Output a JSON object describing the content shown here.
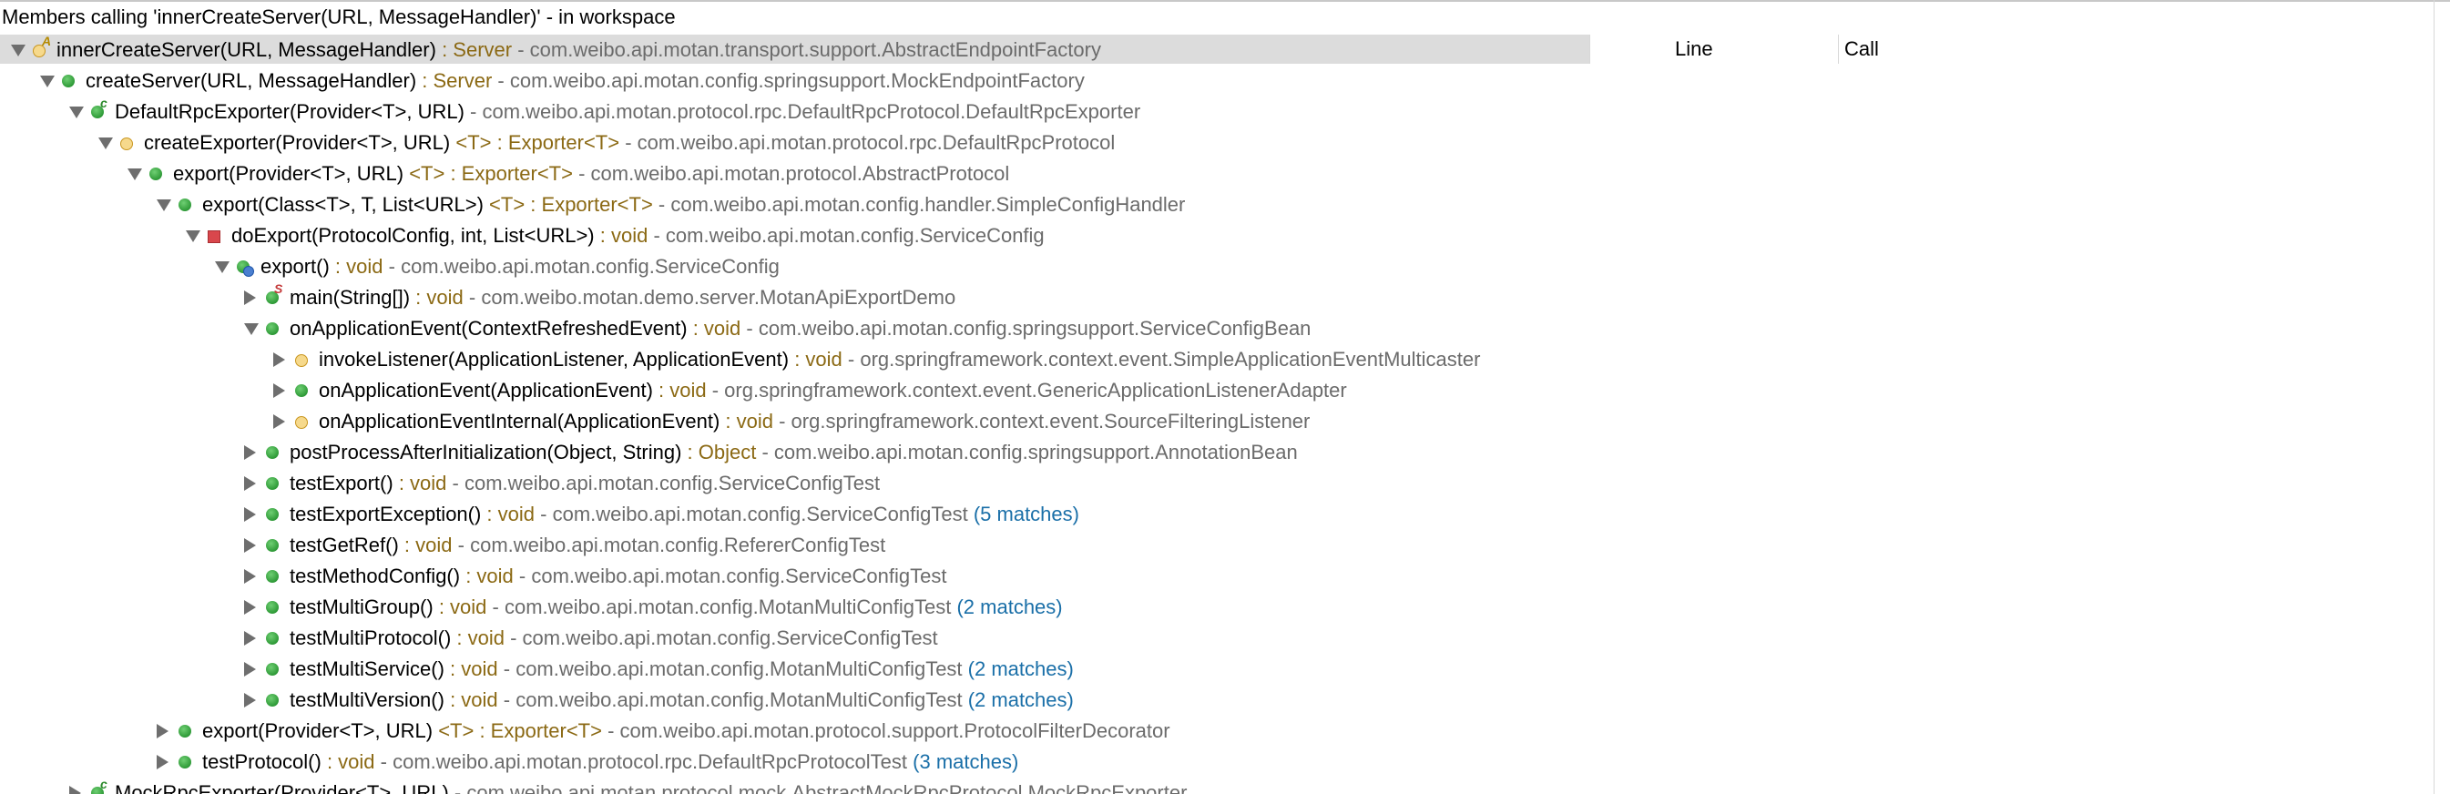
{
  "view_title": "Members calling 'innerCreateServer(URL, MessageHandler)' - in workspace",
  "columns": {
    "line": "Line",
    "call": "Call"
  },
  "rows": [
    {
      "level": 0,
      "twisty": "expanded",
      "icon": "protected-method-abstract-icon",
      "name": "innerCreateServer(URL, MessageHandler)",
      "ret": " : Server",
      "pkg": "com.weibo.api.motan.transport.support.AbstractEndpointFactory",
      "match": "",
      "selected": true
    },
    {
      "level": 1,
      "twisty": "expanded",
      "icon": "public-method-icon",
      "name": "createServer(URL, MessageHandler)",
      "ret": " : Server",
      "pkg": "com.weibo.api.motan.config.springsupport.MockEndpointFactory",
      "match": ""
    },
    {
      "level": 2,
      "twisty": "expanded",
      "icon": "constructor-icon",
      "name": "DefaultRpcExporter(Provider<T>, URL)",
      "ret": "",
      "pkg": "com.weibo.api.motan.protocol.rpc.DefaultRpcProtocol.DefaultRpcExporter",
      "match": ""
    },
    {
      "level": 3,
      "twisty": "expanded",
      "icon": "protected-method-icon",
      "name": "createExporter(Provider<T>, URL)",
      "ret": " <T> : Exporter<T>",
      "pkg": "com.weibo.api.motan.protocol.rpc.DefaultRpcProtocol",
      "match": ""
    },
    {
      "level": 4,
      "twisty": "expanded",
      "icon": "public-method-icon",
      "name": "export(Provider<T>, URL)",
      "ret": " <T> : Exporter<T>",
      "pkg": "com.weibo.api.motan.protocol.AbstractProtocol",
      "match": ""
    },
    {
      "level": 5,
      "twisty": "expanded",
      "icon": "public-method-icon",
      "name": "export(Class<T>, T, List<URL>)",
      "ret": " <T> : Exporter<T>",
      "pkg": "com.weibo.api.motan.config.handler.SimpleConfigHandler",
      "match": ""
    },
    {
      "level": 6,
      "twisty": "expanded",
      "icon": "private-method-icon",
      "name": "doExport(ProtocolConfig, int, List<URL>)",
      "ret": " : void",
      "pkg": "com.weibo.api.motan.config.ServiceConfig",
      "match": ""
    },
    {
      "level": 7,
      "twisty": "expanded",
      "icon": "synchronized-method-icon",
      "name": "export()",
      "ret": " : void",
      "pkg": "com.weibo.api.motan.config.ServiceConfig",
      "match": ""
    },
    {
      "level": 8,
      "twisty": "collapsed",
      "icon": "static-method-icon",
      "name": "main(String[])",
      "ret": " : void",
      "pkg": "com.weibo.motan.demo.server.MotanApiExportDemo",
      "match": ""
    },
    {
      "level": 8,
      "twisty": "expanded",
      "icon": "public-method-icon",
      "name": "onApplicationEvent(ContextRefreshedEvent)",
      "ret": " : void",
      "pkg": "com.weibo.api.motan.config.springsupport.ServiceConfigBean",
      "match": ""
    },
    {
      "level": 9,
      "twisty": "collapsed",
      "icon": "protected-method-icon",
      "name": "invokeListener(ApplicationListener, ApplicationEvent)",
      "ret": " : void",
      "pkg": "org.springframework.context.event.SimpleApplicationEventMulticaster",
      "match": ""
    },
    {
      "level": 9,
      "twisty": "collapsed",
      "icon": "public-method-icon",
      "name": "onApplicationEvent(ApplicationEvent)",
      "ret": " : void",
      "pkg": "org.springframework.context.event.GenericApplicationListenerAdapter",
      "match": ""
    },
    {
      "level": 9,
      "twisty": "collapsed",
      "icon": "protected-method-icon",
      "name": "onApplicationEventInternal(ApplicationEvent)",
      "ret": " : void",
      "pkg": "org.springframework.context.event.SourceFilteringListener",
      "match": ""
    },
    {
      "level": 8,
      "twisty": "collapsed",
      "icon": "public-method-icon",
      "name": "postProcessAfterInitialization(Object, String)",
      "ret": " : Object",
      "pkg": "com.weibo.api.motan.config.springsupport.AnnotationBean",
      "match": ""
    },
    {
      "level": 8,
      "twisty": "collapsed",
      "icon": "public-method-icon",
      "name": "testExport()",
      "ret": " : void",
      "pkg": "com.weibo.api.motan.config.ServiceConfigTest",
      "match": ""
    },
    {
      "level": 8,
      "twisty": "collapsed",
      "icon": "public-method-icon",
      "name": "testExportException()",
      "ret": " : void",
      "pkg": "com.weibo.api.motan.config.ServiceConfigTest",
      "match": "(5 matches)"
    },
    {
      "level": 8,
      "twisty": "collapsed",
      "icon": "public-method-icon",
      "name": "testGetRef()",
      "ret": " : void",
      "pkg": "com.weibo.api.motan.config.RefererConfigTest",
      "match": ""
    },
    {
      "level": 8,
      "twisty": "collapsed",
      "icon": "public-method-icon",
      "name": "testMethodConfig()",
      "ret": " : void",
      "pkg": "com.weibo.api.motan.config.ServiceConfigTest",
      "match": ""
    },
    {
      "level": 8,
      "twisty": "collapsed",
      "icon": "public-method-icon",
      "name": "testMultiGroup()",
      "ret": " : void",
      "pkg": "com.weibo.api.motan.config.MotanMultiConfigTest",
      "match": "(2 matches)"
    },
    {
      "level": 8,
      "twisty": "collapsed",
      "icon": "public-method-icon",
      "name": "testMultiProtocol()",
      "ret": " : void",
      "pkg": "com.weibo.api.motan.config.ServiceConfigTest",
      "match": ""
    },
    {
      "level": 8,
      "twisty": "collapsed",
      "icon": "public-method-icon",
      "name": "testMultiService()",
      "ret": " : void",
      "pkg": "com.weibo.api.motan.config.MotanMultiConfigTest",
      "match": "(2 matches)"
    },
    {
      "level": 8,
      "twisty": "collapsed",
      "icon": "public-method-icon",
      "name": "testMultiVersion()",
      "ret": " : void",
      "pkg": "com.weibo.api.motan.config.MotanMultiConfigTest",
      "match": "(2 matches)"
    },
    {
      "level": 5,
      "twisty": "collapsed",
      "icon": "public-method-icon",
      "name": "export(Provider<T>, URL)",
      "ret": " <T> : Exporter<T>",
      "pkg": "com.weibo.api.motan.protocol.support.ProtocolFilterDecorator",
      "match": ""
    },
    {
      "level": 5,
      "twisty": "collapsed",
      "icon": "public-method-icon",
      "name": "testProtocol()",
      "ret": " : void",
      "pkg": "com.weibo.api.motan.protocol.rpc.DefaultRpcProtocolTest",
      "match": "(3 matches)"
    },
    {
      "level": 2,
      "twisty": "collapsed",
      "icon": "constructor-icon",
      "name": "MockRpcExporter(Provider<T>, URL)",
      "ret": "",
      "pkg": "com.weibo.api.motan.protocol.mock.AbstractMockRpcProtocol.MockRpcExporter",
      "match": ""
    }
  ]
}
